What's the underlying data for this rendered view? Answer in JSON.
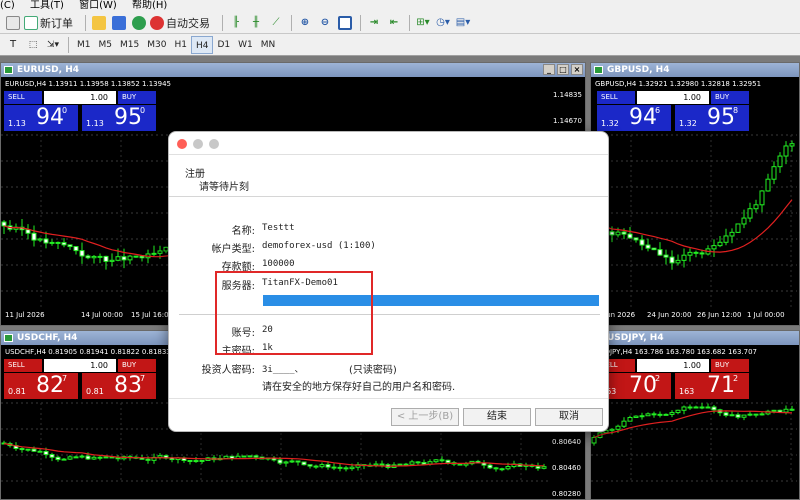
{
  "menu": [
    "(C)",
    "工具(T)",
    "窗口(W)",
    "帮助(H)"
  ],
  "toolbar": {
    "new_order": "新订单",
    "auto_trade": "自动交易"
  },
  "timeframes": [
    "M1",
    "M5",
    "M15",
    "M30",
    "H1",
    "H4",
    "D1",
    "W1",
    "MN"
  ],
  "active_timeframe": "H4",
  "colors": {
    "sell_blue": "#1b28c8",
    "sell_red": "#c21616",
    "candle": "#22ee22",
    "ma": "#e02020",
    "progress": "#2a8ee6"
  },
  "charts": [
    {
      "title": "EURUSD, H4",
      "symbol_line": "EURUSD,H4  1.13911 1.13958 1.13852 1.13945",
      "sell": "SELL",
      "buy": "BUY",
      "lot": "1.00",
      "sell_small": "1.13",
      "sell_big": "94",
      "sell_sup": "0",
      "buy_small": "1.13",
      "buy_big": "95",
      "buy_sup": "0",
      "prices": [
        "1.14835",
        "1.14670"
      ],
      "dates": [
        "11 Jul 2026",
        "14 Jul 00:00",
        "15 Jul 16:00"
      ]
    },
    {
      "title": "GBPUSD, H4",
      "symbol_line": "GBPUSD,H4  1.32921 1.32980 1.32818 1.32951",
      "sell": "SELL",
      "buy": "BUY",
      "lot": "1.00",
      "sell_small": "1.32",
      "sell_big": "94",
      "sell_sup": "6",
      "buy_small": "1.32",
      "buy_big": "95",
      "buy_sup": "8",
      "dates": [
        "23 Jun 2026",
        "24 Jun 20:00",
        "26 Jun 12:00",
        "1 Jul 00:00"
      ]
    },
    {
      "title": "USDCHF, H4",
      "symbol_line": "USDCHF,H4  0.81905 0.81941 0.81822 0.81833",
      "sell": "SELL",
      "buy": "BUY",
      "lot": "1.00",
      "sell_small": "0.81",
      "sell_big": "82",
      "sell_sup": "7",
      "buy_small": "0.81",
      "buy_big": "83",
      "buy_sup": "7"
    },
    {
      "title": "USDJPY, H4",
      "symbol_line": "USDJPY,H4  163.786 163.780 163.682 163.707",
      "sell": "SELL",
      "buy": "BUY",
      "lot": "1.00",
      "sell_small": "163",
      "sell_big": "70",
      "sell_sup": "2",
      "buy_small": "163",
      "buy_big": "71",
      "buy_sup": "2",
      "prices": [
        "0.80640",
        "0.80460",
        "0.80280"
      ]
    }
  ],
  "dialog": {
    "title": "注册",
    "subtitle": "请等待片刻",
    "name_label": "名称:",
    "name_value": "Testtt",
    "type_label": "帐户类型:",
    "type_value": "demoforex-usd (1:100)",
    "deposit_label": "存款额:",
    "deposit_value": "100000",
    "server_label": "服务器:",
    "server_value": "TitanFX-Demo01",
    "account_label": "账号:",
    "account_value": "20",
    "password_label": "主密码:",
    "password_value": "1k",
    "investor_label": "投资人密码:",
    "investor_value": "3i____、",
    "investor_note": "(只读密码)",
    "notice": "请在安全的地方保存好自己的用户名和密码.",
    "back_button": "< 上一步(B)",
    "finish_button": "结束",
    "cancel_button": "取消",
    "progress": 1.0
  }
}
